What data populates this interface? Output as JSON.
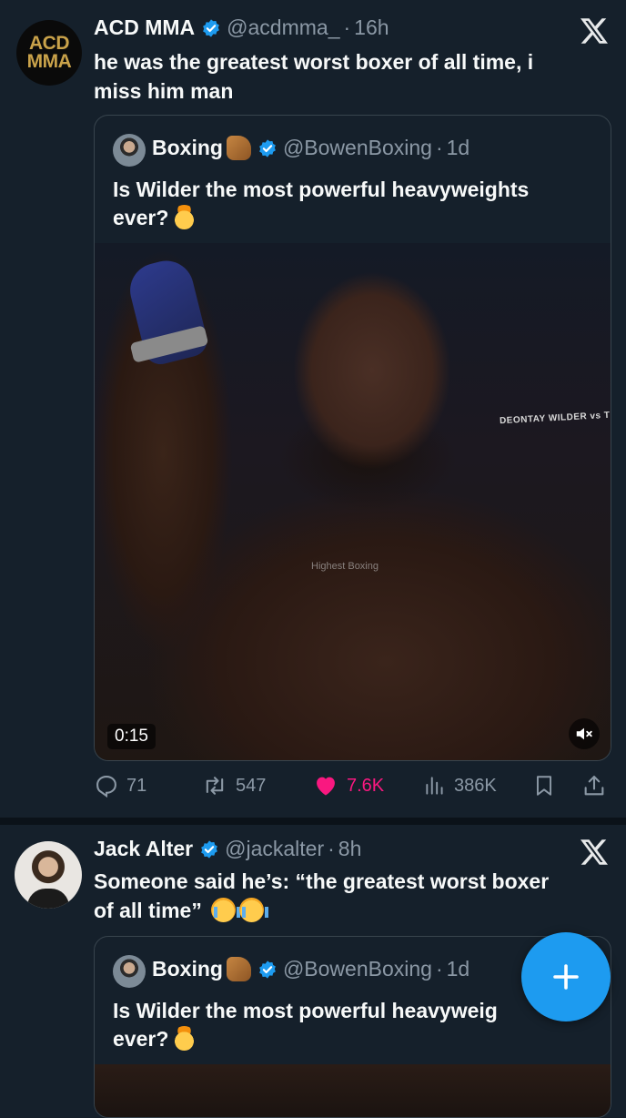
{
  "tweets": [
    {
      "avatar_text": [
        "ACD",
        "MMA"
      ],
      "name": "ACD MMA",
      "handle": "@acdmma_",
      "time": "16h",
      "text_lines": [
        "he was the greatest worst boxer of all time, i",
        "miss him man"
      ],
      "quote": {
        "name": "Boxing",
        "handle": "@BowenBoxing",
        "time": "1d",
        "text_lines": [
          "Is Wilder the most powerful heavyweights",
          "ever?"
        ],
        "video": {
          "overlay_name": "DEONTAY WILDER vs T",
          "watermark": "Highest Boxing",
          "duration": "0:15"
        }
      },
      "actions": {
        "replies": "71",
        "reposts": "547",
        "likes": "7.6K",
        "views": "386K"
      }
    },
    {
      "name": "Jack Alter",
      "handle": "@jackalter",
      "time": "8h",
      "text_lines": [
        "Someone said he’s: “the greatest worst boxer",
        "of all time”"
      ],
      "quote": {
        "name": "Boxing",
        "handle": "@BowenBoxing",
        "time": "1d",
        "text_lines": [
          "Is Wilder the most powerful heavyweig",
          "ever?"
        ]
      }
    }
  ],
  "colors": {
    "background": "#15202b",
    "accent": "#1d9bf0",
    "like": "#f91880",
    "muted": "#8b98a5"
  },
  "icons": {
    "verified": "verified-badge-icon",
    "platform": "x-logo-icon",
    "reply": "reply-icon",
    "repost": "repost-icon",
    "like": "heart-icon",
    "views": "views-icon",
    "bookmark": "bookmark-icon",
    "share": "share-icon",
    "compose": "plus-icon",
    "mute": "mute-icon"
  }
}
